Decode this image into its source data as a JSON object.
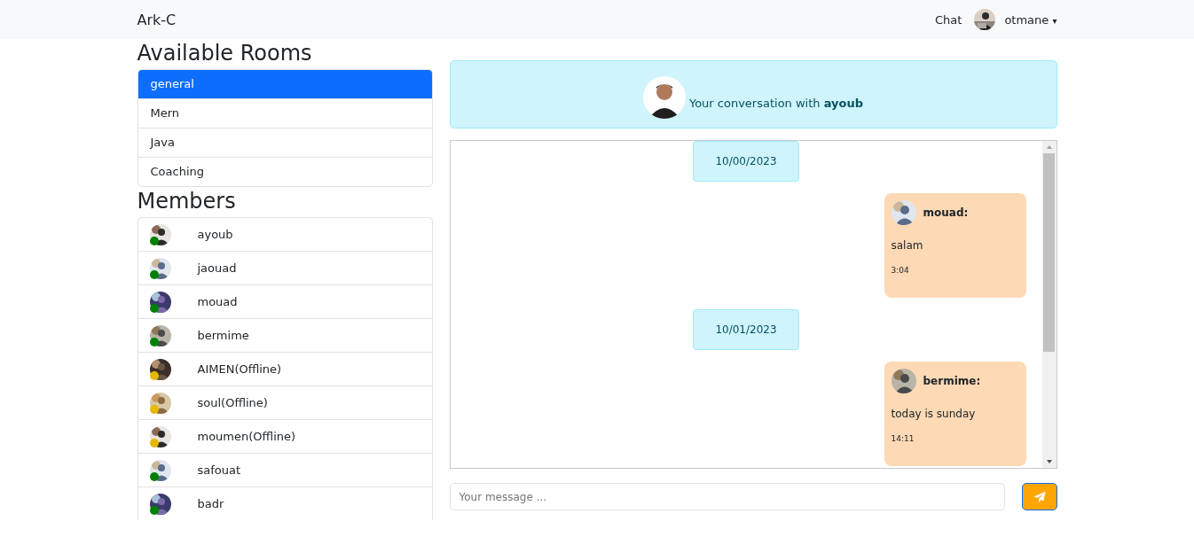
{
  "navbar": {
    "brand": "Ark-C",
    "links": [
      {
        "label": "Chat"
      }
    ],
    "user": {
      "name": "otmane",
      "caret": "▾"
    }
  },
  "rooms": {
    "title": "Available Rooms",
    "items": [
      {
        "label": "general",
        "selected": true
      },
      {
        "label": "Mern",
        "selected": false
      },
      {
        "label": "Java",
        "selected": false
      },
      {
        "label": "Coaching",
        "selected": false
      }
    ]
  },
  "members": {
    "title": "Members",
    "items": [
      {
        "name": "ayoub",
        "online": true
      },
      {
        "name": "jaouad",
        "online": true
      },
      {
        "name": "mouad",
        "online": true
      },
      {
        "name": "bermime",
        "online": true
      },
      {
        "name": "AIMEN(Offline)",
        "online": false
      },
      {
        "name": "soul(Offline)",
        "online": false
      },
      {
        "name": "moumen(Offline)",
        "online": false
      },
      {
        "name": "safouat",
        "online": true
      },
      {
        "name": "badr",
        "online": true
      }
    ]
  },
  "conversation": {
    "header": "Your conversation with **ayoub**",
    "messages": [
      {
        "kind": "date",
        "text": "10/00/2023"
      },
      {
        "kind": "message",
        "author": "mouad:",
        "text": "salam",
        "time": "3:04"
      },
      {
        "kind": "date",
        "text": "10/01/2023"
      },
      {
        "kind": "message",
        "author": "bermime:",
        "text": "today is sunday",
        "time": "14:11"
      }
    ]
  },
  "composer": {
    "placeholder": "Your message ..."
  }
}
